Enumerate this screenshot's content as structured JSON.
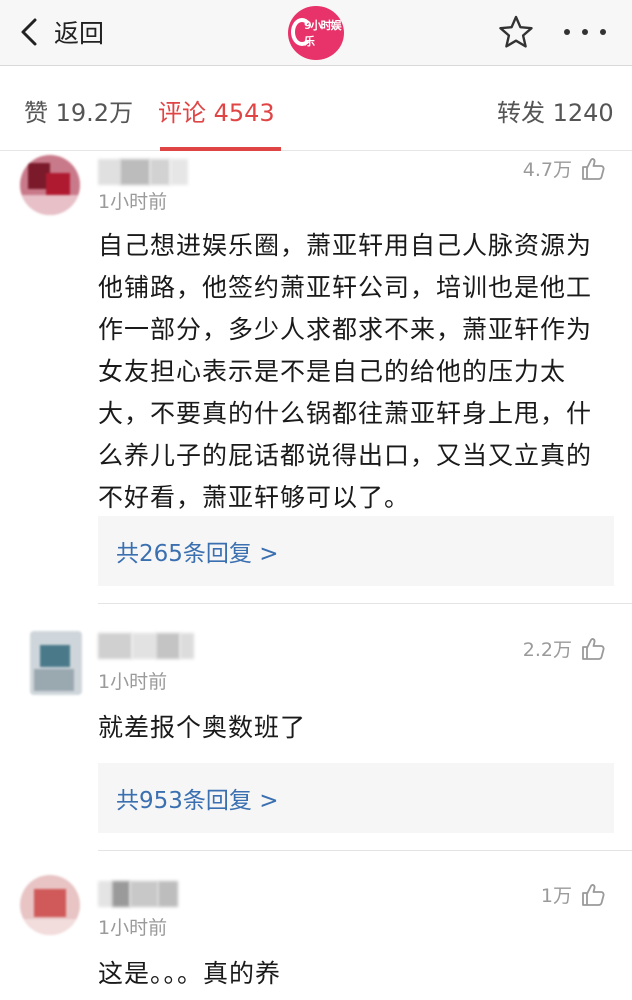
{
  "nav": {
    "back_label": "返回",
    "logo_text": "9小时娱乐"
  },
  "tabs": {
    "like": "赞 19.2万",
    "comments": "评论 4543",
    "share": "转发 1240"
  },
  "colors": {
    "accent": "#e04545",
    "link": "#3a6fb0",
    "logo": "#e8336a"
  },
  "comments": [
    {
      "time": "1小时前",
      "likes": "4.7万",
      "content": "自己想进娱乐圈，萧亚轩用自己人脉资源为他铺路，他签约萧亚轩公司，培训也是他工作一部分，多少人求都求不来，萧亚轩作为女友担心表示是不是自己的给他的压力太大，不要真的什么锅都往萧亚轩身上甩，什么养儿子的屁话都说得出口，又当又立真的不好看，萧亚轩够可以了。",
      "replies": "共265条回复 >"
    },
    {
      "time": "1小时前",
      "likes": "2.2万",
      "content": "就差报个奥数班了",
      "replies": "共953条回复 >"
    },
    {
      "time": "1小时前",
      "likes": "1万",
      "content": "这是。。。真的养"
    }
  ]
}
